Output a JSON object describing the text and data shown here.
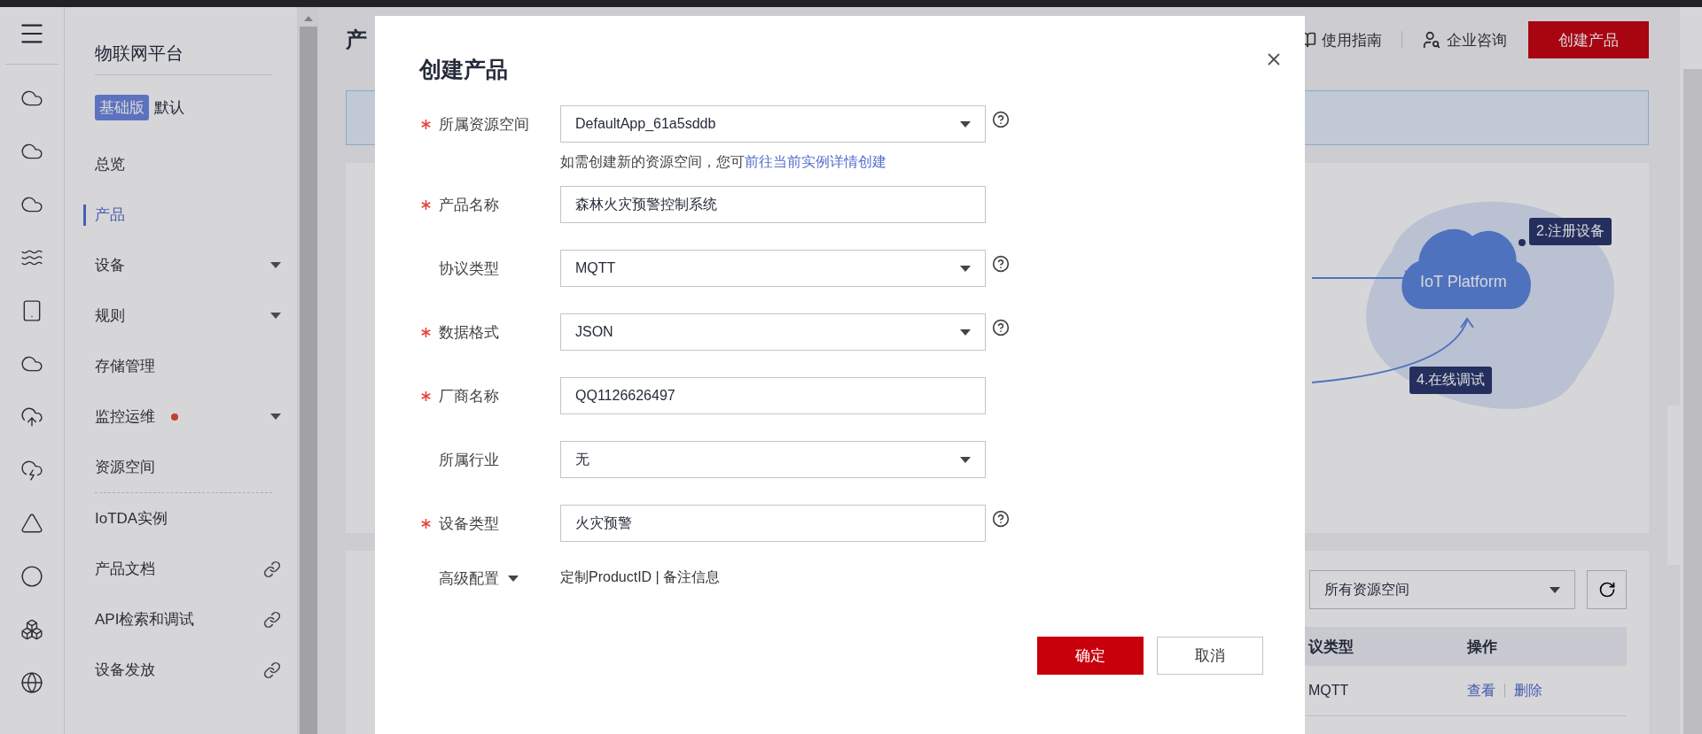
{
  "sidebar": {
    "title": "物联网平台",
    "edition": {
      "badge": "基础版",
      "name": "默认"
    },
    "sections": [
      [
        {
          "label": "总览",
          "kind": "plain",
          "selected": false,
          "dot": false
        },
        {
          "label": "产品",
          "kind": "plain",
          "selected": true,
          "dot": false
        },
        {
          "label": "设备",
          "kind": "dropdown",
          "selected": false,
          "dot": false
        },
        {
          "label": "规则",
          "kind": "dropdown",
          "selected": false,
          "dot": false
        },
        {
          "label": "存储管理",
          "kind": "plain",
          "selected": false,
          "dot": false
        },
        {
          "label": "监控运维",
          "kind": "dropdown",
          "selected": false,
          "dot": true
        },
        {
          "label": "资源空间",
          "kind": "plain",
          "selected": false,
          "dot": false
        }
      ],
      [
        {
          "label": "IoTDA实例",
          "kind": "plain",
          "selected": false,
          "dot": false
        },
        {
          "label": "产品文档",
          "kind": "link",
          "selected": false,
          "dot": false
        },
        {
          "label": "API检索和调试",
          "kind": "link",
          "selected": false,
          "dot": false
        },
        {
          "label": "设备发放",
          "kind": "link",
          "selected": false,
          "dot": false
        }
      ]
    ]
  },
  "header": {
    "title": "产",
    "guide": "使用指南",
    "consult": "企业咨询",
    "create_button": "创建产品"
  },
  "diagram": {
    "platform": "IoT Platform",
    "steps": [
      "2.注册设备",
      "4.在线调试"
    ]
  },
  "filter": {
    "value": "所有资源空间"
  },
  "table": {
    "columns": [
      "议类型",
      "操作"
    ],
    "rows": [
      {
        "protocol": "MQTT",
        "actions": [
          "查看",
          "删除"
        ]
      }
    ]
  },
  "dialog": {
    "title": "创建产品",
    "fields": [
      {
        "label": "所属资源空间",
        "required": true,
        "kind": "select",
        "value": "DefaultApp_61a5sddb",
        "help": true,
        "hint": "如需创建新的资源空间，您可",
        "hint_link": "前往当前实例详情创建"
      },
      {
        "label": "产品名称",
        "required": true,
        "kind": "input",
        "value": "森林火灾预警控制系统",
        "help": false
      },
      {
        "label": "协议类型",
        "required": false,
        "kind": "select",
        "value": "MQTT",
        "help": true
      },
      {
        "label": "数据格式",
        "required": true,
        "kind": "select",
        "value": "JSON",
        "help": true
      },
      {
        "label": "厂商名称",
        "required": true,
        "kind": "input",
        "value": "QQ1126626497",
        "help": false
      },
      {
        "label": "所属行业",
        "required": false,
        "kind": "select",
        "value": "无",
        "help": false
      },
      {
        "label": "设备类型",
        "required": true,
        "kind": "input",
        "value": "火灾预警",
        "help": true
      }
    ],
    "advanced": {
      "label": "高级配置",
      "options": "定制ProductID | 备注信息"
    },
    "buttons": [
      {
        "label": "确定",
        "kind": "primary"
      },
      {
        "label": "取消",
        "kind": "secondary"
      }
    ]
  }
}
